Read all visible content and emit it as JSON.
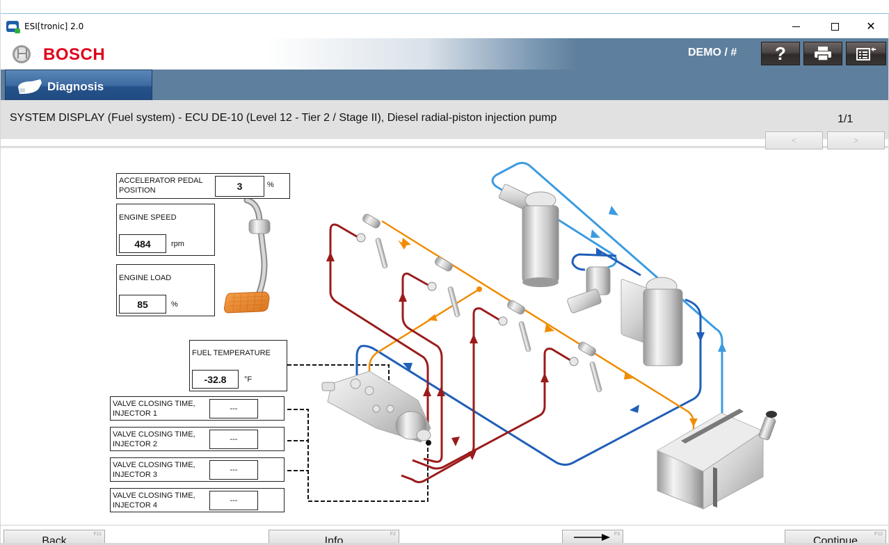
{
  "window": {
    "title": "ESI[tronic] 2.0",
    "controls": [
      "minimize",
      "maximize",
      "close"
    ]
  },
  "header": {
    "brand": "BOSCH",
    "user_label": "DEMO / #",
    "buttons": [
      {
        "name": "help",
        "icon": "question-mark-icon",
        "glyph": "?"
      },
      {
        "name": "print",
        "icon": "printer-icon"
      },
      {
        "name": "exit",
        "icon": "list-exit-icon"
      }
    ]
  },
  "nav": {
    "active_tab": "Diagnosis",
    "tab_icon": "diagnostic-plug-icon"
  },
  "page": {
    "title": "SYSTEM DISPLAY (Fuel system) - ECU DE-10 (Level 12 - Tier 2 / Stage II), Diesel radial-piston injection pump",
    "counter": "1/1",
    "prev_label": "<",
    "next_label": ">"
  },
  "measurements": {
    "accelerator": {
      "label_line1": "ACCELERATOR PEDAL",
      "label_line2": "POSITION",
      "value": "3",
      "unit": "%"
    },
    "engine_speed": {
      "label": "ENGINE SPEED",
      "value": "484",
      "unit": "rpm"
    },
    "engine_load": {
      "label": "ENGINE LOAD",
      "value": "85",
      "unit": "%"
    },
    "fuel_temperature": {
      "label": "FUEL TEMPERATURE",
      "value": "-32.8",
      "unit": "°F"
    },
    "valve_closing": [
      {
        "label_line1": "VALVE CLOSING TIME,",
        "label_line2": "INJECTOR 1",
        "value": "---"
      },
      {
        "label_line1": "VALVE CLOSING TIME,",
        "label_line2": "INJECTOR 2",
        "value": "---"
      },
      {
        "label_line1": "VALVE CLOSING TIME,",
        "label_line2": "INJECTOR 3",
        "value": "---"
      },
      {
        "label_line1": "VALVE CLOSING TIME,",
        "label_line2": "INJECTOR 4",
        "value": "---"
      }
    ]
  },
  "diagram": {
    "components": [
      "accelerator-pedal",
      "injection-pump",
      "injector-1",
      "injector-2",
      "injector-3",
      "injector-4",
      "fuel-prefilter",
      "hand-pump",
      "fuel-filter",
      "fuel-tank"
    ],
    "line_colors": {
      "high_pressure": "#9b1b1b",
      "leak_oil": "#f08c00",
      "supply": "#1f5fb8",
      "return": "#3b9be0"
    }
  },
  "footer": {
    "back": {
      "label": "Back",
      "key": "F11"
    },
    "info": {
      "label": "Info",
      "key": "F2"
    },
    "switch": {
      "label": "",
      "key": "F3",
      "icon": "switch-arrows-icon"
    },
    "continue": {
      "label": "Continue",
      "key": "F12"
    }
  }
}
